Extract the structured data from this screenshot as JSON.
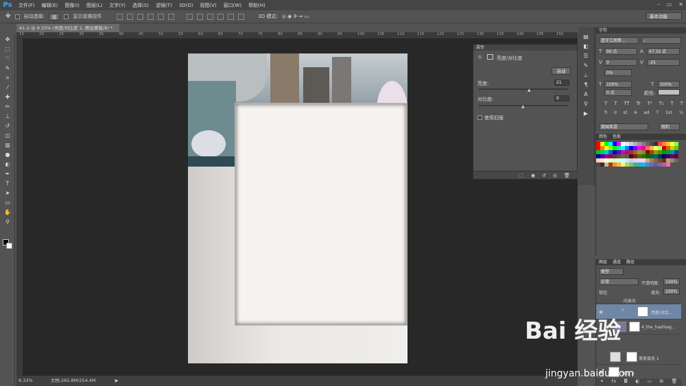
{
  "app": {
    "logo": "Ps"
  },
  "menubar": {
    "items": [
      "文件(F)",
      "编辑(E)",
      "图像(I)",
      "图层(L)",
      "文字(Y)",
      "选择(S)",
      "滤镜(T)",
      "3D(D)",
      "视图(V)",
      "窗口(W)",
      "帮助(H)"
    ],
    "window_controls": [
      "–",
      "▭",
      "✕"
    ]
  },
  "options": {
    "auto_select_label": "自动选择:",
    "auto_select_value": "组",
    "show_transform_label": "显示变换控件",
    "mode_3d_label": "3D 模式:",
    "workspace": "基本功能"
  },
  "document": {
    "tab_title": "A1-2 @ 8.33% (亮度/对比度 2, 图层蒙版/8) *",
    "ruler_ticks": [
      "15",
      "20",
      "25",
      "30",
      "35",
      "40",
      "45",
      "50",
      "55",
      "60",
      "65",
      "70",
      "75",
      "80",
      "85",
      "90",
      "95",
      "100",
      "105",
      "110",
      "115",
      "120",
      "125",
      "130",
      "135",
      "140",
      "145",
      "150"
    ],
    "status_zoom": "8.33%",
    "status_doc": "文档:265.8M/254.4M"
  },
  "properties": {
    "header": "属性",
    "adjustment_title": "亮度/对比度",
    "auto_button": "自动",
    "brightness_label": "亮度:",
    "brightness_value": "21",
    "contrast_label": "对比度:",
    "contrast_value": "0",
    "legacy_label": "使用旧版"
  },
  "character": {
    "header": "字符",
    "font_family": "造字工房新...",
    "font_style": "-",
    "size": "90 点",
    "leading": "47.32 点",
    "kerning": "0",
    "tracking": "-25",
    "baseline_scale": "0%",
    "vscale": "100%",
    "hscale": "100%",
    "baseline_shift": "0 点",
    "color_label": "颜色:",
    "language": "美国英语",
    "antialias": "锐利",
    "style_buttons": [
      "T",
      "T",
      "TT",
      "Tr",
      "T¹",
      "T₁",
      "T",
      "T"
    ],
    "style_buttons_2": [
      "fi",
      "ơ",
      "st",
      "A",
      "ad",
      "T",
      "1st",
      "½"
    ]
  },
  "swatches": {
    "tabs": [
      "颜色",
      "色板"
    ],
    "colors": [
      "#ff0000",
      "#ffff00",
      "#00ff00",
      "#00ffff",
      "#0000ff",
      "#ff00ff",
      "#ffffff",
      "#e6e6e6",
      "#cccccc",
      "#b3b3b3",
      "#999999",
      "#808080",
      "#666666",
      "#4d4d4d",
      "#333333",
      "#ff4040",
      "#ff8040",
      "#ffbf40",
      "#ffff40",
      "#80ff40",
      "#ff0000",
      "#ff8000",
      "#ffff00",
      "#80ff00",
      "#00ff00",
      "#00ff80",
      "#00ffff",
      "#0080ff",
      "#0000ff",
      "#8000ff",
      "#ff00ff",
      "#ff0080",
      "#ff6666",
      "#ffb366",
      "#ffff66",
      "#b3ff66",
      "#cc0000",
      "#cc6600",
      "#cccc00",
      "#66cc00",
      "#00cc00",
      "#00cc66",
      "#00cccc",
      "#0066cc",
      "#0000cc",
      "#6600cc",
      "#cc00cc",
      "#cc0066",
      "#993333",
      "#996633",
      "#999933",
      "#669933",
      "#990000",
      "#994c00",
      "#999900",
      "#4c9900",
      "#009900",
      "#00994c",
      "#009999",
      "#004c99",
      "#000099",
      "#4c0099",
      "#990099",
      "#99004c",
      "#663333",
      "#664d33",
      "#666633",
      "#4d6633",
      "#660000",
      "#663300",
      "#666600",
      "#336600",
      "#006600",
      "#006633",
      "#006666",
      "#003366",
      "#000066",
      "#330066",
      "#660066",
      "#660033",
      "#ffcccc",
      "#ffe6cc",
      "#ffffcc",
      "#e6ffcc",
      "#ccffcc",
      "#ccffe6",
      "#ccffff",
      "#cce6ff",
      "#ccccff",
      "#e6ccff",
      "#ffccff",
      "#ffcce6",
      "#c8a882",
      "#a67c52",
      "#8c6239",
      "#754c24",
      "#603813",
      "#c69c6d",
      "#998675",
      "#736357",
      "#534741",
      "#362f2d",
      "#c7b299",
      "#a0410d",
      "#f7941d",
      "#fbaf5d",
      "#fff568",
      "#acd373",
      "#7cc576",
      "#3cb878",
      "#1cbbb4",
      "#00bff3",
      "#448ccb",
      "#5674b9",
      "#605ca8",
      "#855fa8",
      "#a763a8",
      "#f06eaa"
    ]
  },
  "layers": {
    "tabs": [
      "图层",
      "通道",
      "路径"
    ],
    "filter_kind": "类型",
    "blend_mode": "正常",
    "opacity_label": "不透明度:",
    "opacity_value": "100%",
    "lock_label": "锁定:",
    "fill_label": "填充:",
    "fill_value": "100%",
    "items": [
      {
        "name": "内发光"
      },
      {
        "name": "亮度/对比..."
      },
      {
        "name": "4_the_hashtag..."
      },
      {
        "name": "渐变填充 1"
      },
      {
        "name": "图层 0"
      }
    ]
  },
  "watermark": {
    "text": "Bai 经验",
    "url": "jingyan.baidu.com"
  }
}
